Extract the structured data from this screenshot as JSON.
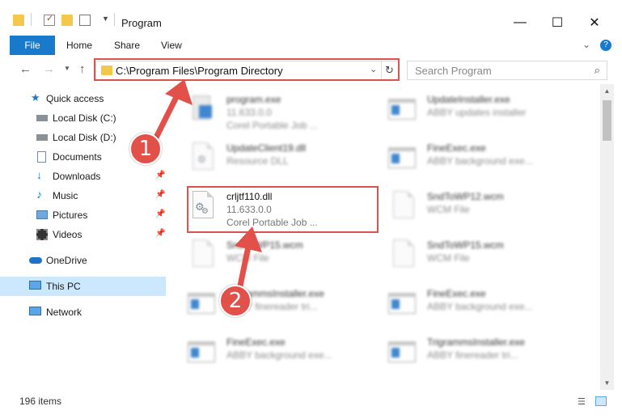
{
  "window": {
    "title": "Program",
    "controls": {
      "minimize": "—",
      "maximize": "☐",
      "close": "✕"
    }
  },
  "ribbon": {
    "file_label": "File",
    "tabs": [
      "Home",
      "Share",
      "View"
    ],
    "expand_icon": "chevron-down-icon",
    "help_label": "?"
  },
  "address_bar": {
    "path": "C:\\Program Files\\Program Directory",
    "search_placeholder": "Search Program"
  },
  "sidebar": {
    "items": [
      {
        "label": "Quick access",
        "icon": "star-icon",
        "pinned": false
      },
      {
        "label": "Local Disk (C:)",
        "icon": "drive-icon",
        "pinned": true
      },
      {
        "label": "Local Disk (D:)",
        "icon": "drive-icon",
        "pinned": true
      },
      {
        "label": "Documents",
        "icon": "documents-icon",
        "pinned": true
      },
      {
        "label": "Downloads",
        "icon": "download-icon",
        "pinned": true
      },
      {
        "label": "Music",
        "icon": "music-icon",
        "pinned": true
      },
      {
        "label": "Pictures",
        "icon": "pictures-icon",
        "pinned": true
      },
      {
        "label": "Videos",
        "icon": "videos-icon",
        "pinned": true
      },
      {
        "label": "OneDrive",
        "icon": "cloud-icon",
        "pinned": false
      },
      {
        "label": "This PC",
        "icon": "computer-icon",
        "pinned": false,
        "selected": true
      },
      {
        "label": "Network",
        "icon": "network-icon",
        "pinned": false
      }
    ]
  },
  "files": [
    {
      "name": "program.exe",
      "line2": "11.633.0.0",
      "line3": "Corel Portable Job ...",
      "icon": "installer-icon",
      "blurred": true
    },
    {
      "name": "UpdateInstaller.exe",
      "line2": "ABBY updates installer",
      "line3": "",
      "icon": "exe-icon",
      "blurred": true
    },
    {
      "name": "UpdateClient19.dll",
      "line2": "Resource DLL",
      "line3": "",
      "icon": "dll-icon",
      "blurred": true
    },
    {
      "name": "FineExec.exe",
      "line2": "ABBY background exe...",
      "line3": "",
      "icon": "exe-icon",
      "blurred": true
    },
    {
      "name": "crljtf110.dll",
      "line2": "11.633.0.0",
      "line3": "Corel Portable Job ...",
      "icon": "dll-gear-icon",
      "blurred": false
    },
    {
      "name": "SndToWP12.wcm",
      "line2": "WCM File",
      "line3": "",
      "icon": "blank-file-icon",
      "blurred": true
    },
    {
      "name": "SndToWP15.wcm",
      "line2": "WCM File",
      "line3": "",
      "icon": "blank-file-icon",
      "blurred": true
    },
    {
      "name": "SndToWP15.wcm",
      "line2": "WCM File",
      "line3": "",
      "icon": "blank-file-icon",
      "blurred": true
    },
    {
      "name": "TrigrammsInstaller.exe",
      "line2": "ABBY finereader tri...",
      "line3": "",
      "icon": "exe-icon",
      "blurred": true
    },
    {
      "name": "FineExec.exe",
      "line2": "ABBY background exe...",
      "line3": "",
      "icon": "exe-icon",
      "blurred": true
    },
    {
      "name": "FineExec.exe",
      "line2": "ABBY background exe...",
      "line3": "",
      "icon": "exe-icon",
      "blurred": true
    },
    {
      "name": "TrigrammsInstaller.exe",
      "line2": "ABBY finereader tri...",
      "line3": "",
      "icon": "exe-icon",
      "blurred": true
    }
  ],
  "status": {
    "item_count": "196 items"
  },
  "annotations": {
    "step1": "1",
    "step2": "2",
    "highlight_color": "#d9534f",
    "badge_color": "#e2504a"
  },
  "colors": {
    "accent": "#1979ca",
    "selection": "#cce8ff"
  }
}
